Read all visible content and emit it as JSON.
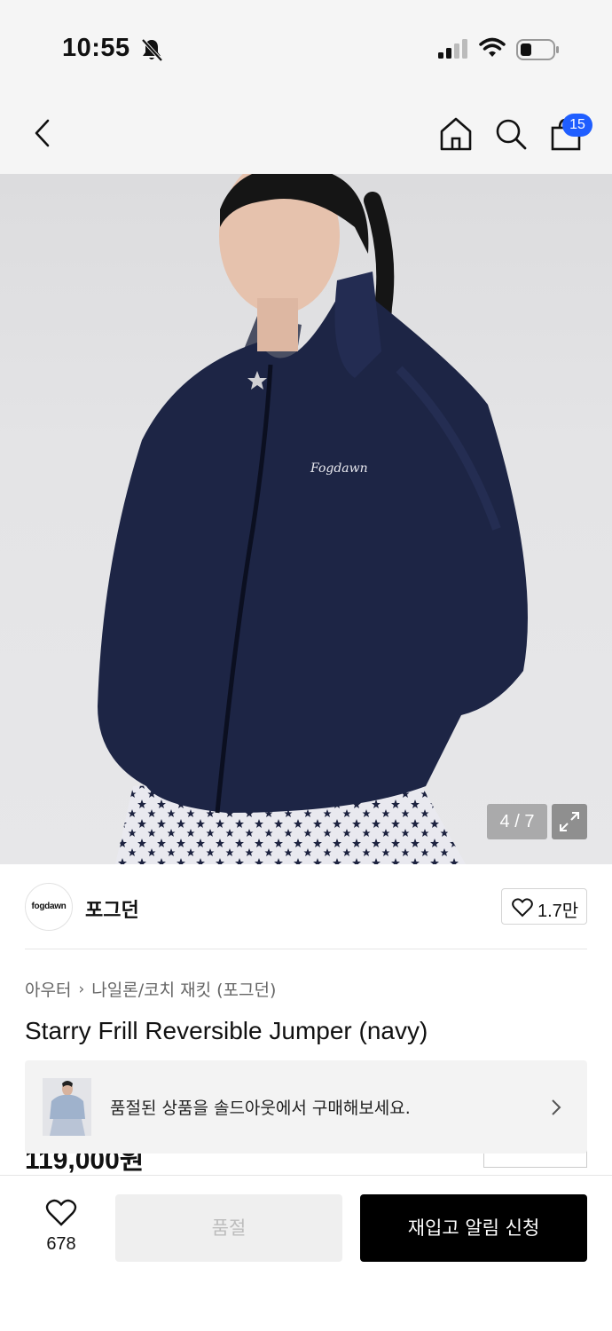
{
  "status_bar": {
    "time": "10:55",
    "icons": [
      "bell-slash-icon",
      "cellular-signal-icon",
      "wifi-icon",
      "battery-icon"
    ]
  },
  "nav": {
    "icons": [
      "chevron-left-icon",
      "home-icon",
      "search-icon",
      "shopping-bag-icon"
    ],
    "cart_badge": "15",
    "badge_color": "#1f5eff"
  },
  "gallery": {
    "counter": "4 / 7",
    "expand_icon": "expand-icon"
  },
  "brand": {
    "logo_text": "fogdawn",
    "name": "포그던",
    "like_count": "1.7만"
  },
  "product": {
    "breadcrumb": [
      "아우터",
      "나일론/코치 재킷 (포그던)"
    ],
    "title": "Starry Frill Reversible Jumper (navy)",
    "price_partial": "119,000원"
  },
  "soldout_banner": {
    "text": "품절된 상품을 솔드아웃에서 구매해보세요."
  },
  "bottom_bar": {
    "wish_count": "678",
    "soldout_label": "품절",
    "restock_label": "재입고 알림 신청"
  }
}
